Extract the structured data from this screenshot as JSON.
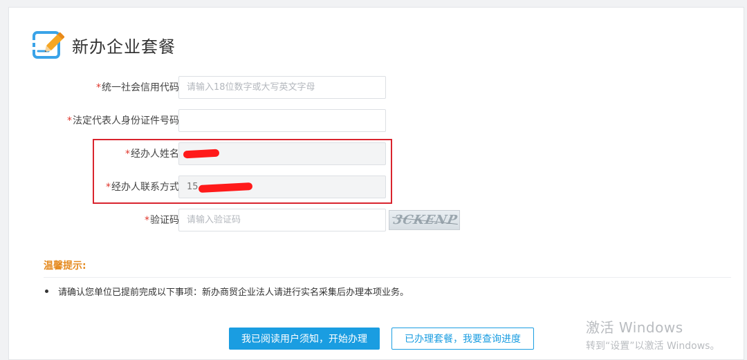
{
  "page": {
    "title": "新办企业套餐"
  },
  "form": {
    "credit_code": {
      "required": "*",
      "label": "统一社会信用代码",
      "placeholder": "请输入18位数字或大写英文字母",
      "value": ""
    },
    "legal_rep_id": {
      "required": "*",
      "label": "法定代表人身份证件号码",
      "placeholder": "",
      "value": ""
    },
    "agent_name": {
      "required": "*",
      "label": "经办人姓名",
      "value": ""
    },
    "agent_contact": {
      "required": "*",
      "label": "经办人联系方式",
      "value": "15"
    },
    "captcha": {
      "required": "*",
      "label": "验证码",
      "placeholder": "请输入验证码",
      "value": "",
      "image_text": "3CKENP"
    }
  },
  "tips": {
    "title": "温馨提示:",
    "items": [
      "请确认您单位已提前完成以下事项：新办商贸企业法人请进行实名采集后办理本项业务。"
    ]
  },
  "buttons": {
    "start": "我已阅读用户须知，开始办理",
    "query": "已办理套餐，我要查询进度"
  },
  "watermark": {
    "title": "激活 Windows",
    "subtitle": "转到“设置”以激活 Windows。"
  },
  "colors": {
    "accent": "#1a9de1",
    "required": "#e0352b",
    "tips": "#e58a1f",
    "highlight": "#d9232d"
  }
}
